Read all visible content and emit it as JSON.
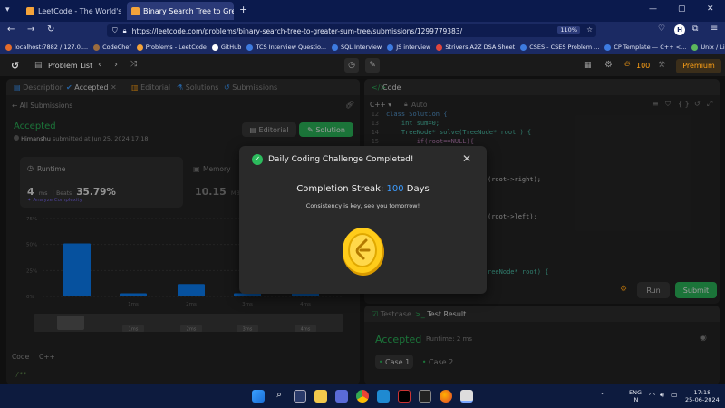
{
  "browser": {
    "tabs": [
      {
        "title": "LeetCode - The World's Leading",
        "fav_color": "#f4a33a"
      },
      {
        "title": "Binary Search Tree to Greater Su",
        "fav_color": "#f4a33a"
      }
    ],
    "new_tab": "+",
    "url": "https://leetcode.com/problems/binary-search-tree-to-greater-sum-tree/submissions/1299779383/",
    "zoom": "110%",
    "bookmarks": [
      {
        "label": "localhost:7882 / 127.0....",
        "color": "#e36b2b"
      },
      {
        "label": "CodeChef",
        "color": "#9b6b3e"
      },
      {
        "label": "Problems - LeetCode",
        "color": "#f4a33a"
      },
      {
        "label": "GitHub",
        "color": "#ffffff"
      },
      {
        "label": "TCS Interview Questio...",
        "color": "#3d7be0"
      },
      {
        "label": "SQL Interview",
        "color": "#3d7be0"
      },
      {
        "label": "JS interview",
        "color": "#3d7be0"
      },
      {
        "label": "Strivers A2Z DSA Sheet",
        "color": "#e0463d"
      },
      {
        "label": "CSES - CSES Problem ...",
        "color": "#3d7be0"
      },
      {
        "label": "CP Template — C++ <...",
        "color": "#3d7be0"
      },
      {
        "label": "Unix / Linux - Shell Ba...",
        "color": "#5cb85c"
      }
    ]
  },
  "lc": {
    "problem_list": "Problem List",
    "streak_count": "100",
    "premium": "Premium",
    "left_tabs": {
      "description": "Description",
      "accepted": "Accepted",
      "editorial": "Editorial",
      "solutions": "Solutions",
      "submissions": "Submissions"
    },
    "all_submissions": "All Submissions",
    "status": "Accepted",
    "user": "Himanshu",
    "submitted_text": "submitted at Jun 25, 2024 17:18",
    "editorial_btn": "Editorial",
    "solution_btn": "Solution",
    "runtime": {
      "label": "Runtime",
      "value": "4",
      "unit": "ms",
      "beats_label": "Beats",
      "beats": "35.79%",
      "analyze": "Analyze Complexity"
    },
    "memory": {
      "label": "Memory",
      "value": "10.15",
      "unit": "MB"
    },
    "y_ticks": [
      "75%",
      "50%",
      "25%",
      "0%"
    ],
    "x_ticks": [
      "1ms",
      "2ms",
      "3ms",
      "4ms"
    ],
    "mini_ticks": [
      "1ms",
      "2ms",
      "3ms",
      "4ms"
    ],
    "bars": [
      51,
      3,
      12,
      3,
      5
    ],
    "code_tabs": {
      "code": "Code",
      "lang": "C++"
    },
    "left_code_line": "/**",
    "code": {
      "title": "Code",
      "lang": "C++",
      "auto": "Auto",
      "lines": [
        {
          "n": "12",
          "t": "class Solution {"
        },
        {
          "n": "13",
          "t": "    int sum=0;"
        },
        {
          "n": "14",
          "t": "    TreeNode* solve(TreeNode* root ) {"
        },
        {
          "n": "15",
          "t": "        if(root==NULL){"
        }
      ],
      "frag1": "(root->right);",
      "frag2": "(root->left);",
      "frag3": "reeNode* root) {"
    },
    "run": "Run",
    "submit": "Submit",
    "testcase_tab": "Testcase",
    "result_tab": "Test Result",
    "result_status": "Accepted",
    "result_runtime": "Runtime: 2 ms",
    "cases": [
      "Case 1",
      "Case 2"
    ]
  },
  "modal": {
    "title": "Daily Coding Challenge Completed!",
    "streak_label": "Completion Streak:",
    "streak_value": "100",
    "streak_unit": "Days",
    "message": "Consistency is key, see you tomorrow!"
  },
  "taskbar": {
    "lang": "ENG",
    "region": "IN",
    "time": "17:18",
    "date": "25-06-2024"
  },
  "colors": {
    "accent_green": "#2cbb5d",
    "accent_orange": "#ffa116",
    "link_blue": "#3c9cff"
  }
}
